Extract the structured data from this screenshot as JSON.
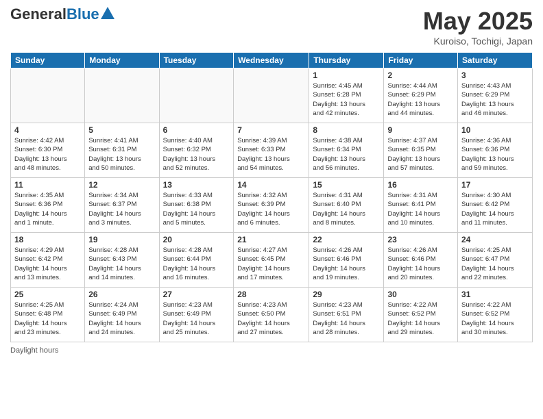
{
  "header": {
    "logo_general": "General",
    "logo_blue": "Blue",
    "month": "May 2025",
    "location": "Kuroiso, Tochigi, Japan"
  },
  "weekdays": [
    "Sunday",
    "Monday",
    "Tuesday",
    "Wednesday",
    "Thursday",
    "Friday",
    "Saturday"
  ],
  "footer": "Daylight hours",
  "weeks": [
    [
      {
        "day": "",
        "info": ""
      },
      {
        "day": "",
        "info": ""
      },
      {
        "day": "",
        "info": ""
      },
      {
        "day": "",
        "info": ""
      },
      {
        "day": "1",
        "info": "Sunrise: 4:45 AM\nSunset: 6:28 PM\nDaylight: 13 hours\nand 42 minutes."
      },
      {
        "day": "2",
        "info": "Sunrise: 4:44 AM\nSunset: 6:29 PM\nDaylight: 13 hours\nand 44 minutes."
      },
      {
        "day": "3",
        "info": "Sunrise: 4:43 AM\nSunset: 6:29 PM\nDaylight: 13 hours\nand 46 minutes."
      }
    ],
    [
      {
        "day": "4",
        "info": "Sunrise: 4:42 AM\nSunset: 6:30 PM\nDaylight: 13 hours\nand 48 minutes."
      },
      {
        "day": "5",
        "info": "Sunrise: 4:41 AM\nSunset: 6:31 PM\nDaylight: 13 hours\nand 50 minutes."
      },
      {
        "day": "6",
        "info": "Sunrise: 4:40 AM\nSunset: 6:32 PM\nDaylight: 13 hours\nand 52 minutes."
      },
      {
        "day": "7",
        "info": "Sunrise: 4:39 AM\nSunset: 6:33 PM\nDaylight: 13 hours\nand 54 minutes."
      },
      {
        "day": "8",
        "info": "Sunrise: 4:38 AM\nSunset: 6:34 PM\nDaylight: 13 hours\nand 56 minutes."
      },
      {
        "day": "9",
        "info": "Sunrise: 4:37 AM\nSunset: 6:35 PM\nDaylight: 13 hours\nand 57 minutes."
      },
      {
        "day": "10",
        "info": "Sunrise: 4:36 AM\nSunset: 6:36 PM\nDaylight: 13 hours\nand 59 minutes."
      }
    ],
    [
      {
        "day": "11",
        "info": "Sunrise: 4:35 AM\nSunset: 6:36 PM\nDaylight: 14 hours\nand 1 minute."
      },
      {
        "day": "12",
        "info": "Sunrise: 4:34 AM\nSunset: 6:37 PM\nDaylight: 14 hours\nand 3 minutes."
      },
      {
        "day": "13",
        "info": "Sunrise: 4:33 AM\nSunset: 6:38 PM\nDaylight: 14 hours\nand 5 minutes."
      },
      {
        "day": "14",
        "info": "Sunrise: 4:32 AM\nSunset: 6:39 PM\nDaylight: 14 hours\nand 6 minutes."
      },
      {
        "day": "15",
        "info": "Sunrise: 4:31 AM\nSunset: 6:40 PM\nDaylight: 14 hours\nand 8 minutes."
      },
      {
        "day": "16",
        "info": "Sunrise: 4:31 AM\nSunset: 6:41 PM\nDaylight: 14 hours\nand 10 minutes."
      },
      {
        "day": "17",
        "info": "Sunrise: 4:30 AM\nSunset: 6:42 PM\nDaylight: 14 hours\nand 11 minutes."
      }
    ],
    [
      {
        "day": "18",
        "info": "Sunrise: 4:29 AM\nSunset: 6:42 PM\nDaylight: 14 hours\nand 13 minutes."
      },
      {
        "day": "19",
        "info": "Sunrise: 4:28 AM\nSunset: 6:43 PM\nDaylight: 14 hours\nand 14 minutes."
      },
      {
        "day": "20",
        "info": "Sunrise: 4:28 AM\nSunset: 6:44 PM\nDaylight: 14 hours\nand 16 minutes."
      },
      {
        "day": "21",
        "info": "Sunrise: 4:27 AM\nSunset: 6:45 PM\nDaylight: 14 hours\nand 17 minutes."
      },
      {
        "day": "22",
        "info": "Sunrise: 4:26 AM\nSunset: 6:46 PM\nDaylight: 14 hours\nand 19 minutes."
      },
      {
        "day": "23",
        "info": "Sunrise: 4:26 AM\nSunset: 6:46 PM\nDaylight: 14 hours\nand 20 minutes."
      },
      {
        "day": "24",
        "info": "Sunrise: 4:25 AM\nSunset: 6:47 PM\nDaylight: 14 hours\nand 22 minutes."
      }
    ],
    [
      {
        "day": "25",
        "info": "Sunrise: 4:25 AM\nSunset: 6:48 PM\nDaylight: 14 hours\nand 23 minutes."
      },
      {
        "day": "26",
        "info": "Sunrise: 4:24 AM\nSunset: 6:49 PM\nDaylight: 14 hours\nand 24 minutes."
      },
      {
        "day": "27",
        "info": "Sunrise: 4:23 AM\nSunset: 6:49 PM\nDaylight: 14 hours\nand 25 minutes."
      },
      {
        "day": "28",
        "info": "Sunrise: 4:23 AM\nSunset: 6:50 PM\nDaylight: 14 hours\nand 27 minutes."
      },
      {
        "day": "29",
        "info": "Sunrise: 4:23 AM\nSunset: 6:51 PM\nDaylight: 14 hours\nand 28 minutes."
      },
      {
        "day": "30",
        "info": "Sunrise: 4:22 AM\nSunset: 6:52 PM\nDaylight: 14 hours\nand 29 minutes."
      },
      {
        "day": "31",
        "info": "Sunrise: 4:22 AM\nSunset: 6:52 PM\nDaylight: 14 hours\nand 30 minutes."
      }
    ]
  ]
}
